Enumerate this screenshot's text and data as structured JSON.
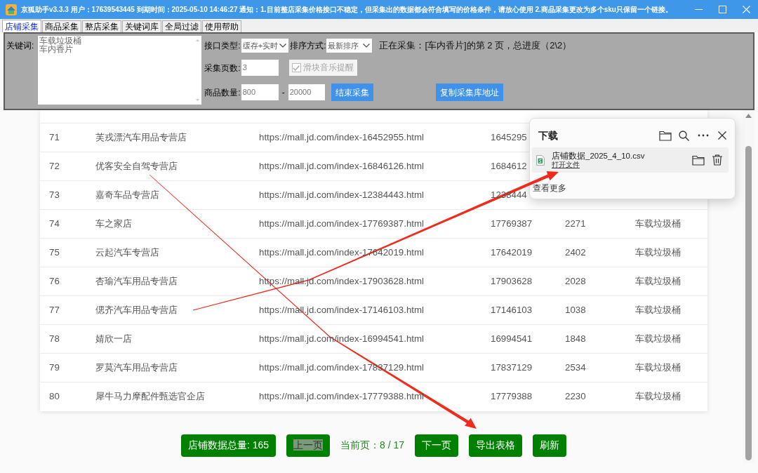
{
  "window": {
    "title": "京狐助手v3.3.3 用户：17639543445 到期时间：2025-05-10 14:46:27 通知：1.目前整店采集价格接口不稳定，但采集出的数据都会符合填写的价格条件，请放心使用 2.商品采集更改为多个sku只保留一个链接。"
  },
  "tabs": [
    {
      "label": "店铺采集",
      "selected": true
    },
    {
      "label": "商品采集",
      "selected": false
    },
    {
      "label": "整店采集",
      "selected": false
    },
    {
      "label": "关键词库",
      "selected": false
    },
    {
      "label": "全局过滤",
      "selected": false
    },
    {
      "label": "使用帮助",
      "selected": false
    }
  ],
  "controls": {
    "keywords": {
      "label": "关键词:",
      "lines": [
        "车载垃圾桶",
        "车内香片"
      ]
    },
    "interface_type": {
      "label": "接口类型:",
      "value": "缓存+实时"
    },
    "sort": {
      "label": "排序方式:",
      "value": "最新排序"
    },
    "status": "正在采集：[车内香片]的第 2 页，总进度（2\\2）",
    "pages": {
      "label": "采集页数:",
      "value": "3"
    },
    "slider_alert": {
      "label": "滑块音乐提醒",
      "checked": true,
      "disabled": true
    },
    "item_count": {
      "label": "商品数量:",
      "min": "800",
      "separator": "-",
      "max": "20000"
    },
    "buttons": [
      {
        "kind": "stop",
        "label": "结束采集"
      },
      {
        "kind": "copy",
        "label": "复制采集库地址"
      }
    ]
  },
  "table": {
    "rows": [
      {
        "cells": [
          "71",
          "芙戎漂汽车用品专营店",
          "https://mall.jd.com/index-16452955.html",
          "1645295"
        ]
      },
      {
        "cells": [
          "72",
          "优客安全自驾专营店",
          "https://mall.jd.com/index-16846126.html",
          "1684612"
        ]
      },
      {
        "cells": [
          "73",
          "嘉奇车品专营店",
          "https://mall.jd.com/index-12384443.html",
          "1238444"
        ]
      },
      {
        "cells": [
          "74",
          "车之家店",
          "https://mall.jd.com/index-17769387.html",
          "17769387",
          "2271",
          "车载垃圾桶"
        ]
      },
      {
        "cells": [
          "75",
          "云起汽车专营店",
          "https://mall.jd.com/index-17642019.html",
          "17642019",
          "2402",
          "车载垃圾桶"
        ]
      },
      {
        "cells": [
          "76",
          "杏瑜汽车用品专营店",
          "https://mall.jd.com/index-17903628.html",
          "17903628",
          "2028",
          "车载垃圾桶"
        ]
      },
      {
        "cells": [
          "77",
          "偲齐汽车用品专营店",
          "https://mall.jd.com/index-17146103.html",
          "17146103",
          "1038",
          "车载垃圾桶"
        ]
      },
      {
        "cells": [
          "78",
          "婧欣一店",
          "https://mall.jd.com/index-16994541.html",
          "16994541",
          "1848",
          "车载垃圾桶"
        ]
      },
      {
        "cells": [
          "79",
          "罗莫汽车用品专营店",
          "https://mall.jd.com/index-17837129.html",
          "17837129",
          "2534",
          "车载垃圾桶"
        ]
      },
      {
        "cells": [
          "80",
          "犀牛马力摩配件甄选官企店",
          "https://mall.jd.com/index-17779388.html",
          "17779388",
          "2230",
          "车载垃圾桶"
        ]
      }
    ]
  },
  "pager": [
    {
      "kind": "button",
      "label": "店铺数据总量: 165",
      "highlighted": false
    },
    {
      "kind": "button",
      "label": "上一页",
      "highlighted": true
    },
    {
      "kind": "text",
      "label": "当前页：8 / 17"
    },
    {
      "kind": "button",
      "label": "下一页",
      "highlighted": false
    },
    {
      "kind": "button",
      "label": "导出表格",
      "highlighted": false
    },
    {
      "kind": "button",
      "label": "刷新",
      "highlighted": false
    }
  ],
  "download_panel": {
    "title": "下载",
    "items": [
      {
        "filename": "店铺数据_2025_4_10.csv",
        "action": "打开文件"
      }
    ],
    "more": "查看更多"
  },
  "annotation_arrows": [
    {
      "kind": "arrow"
    },
    {
      "kind": "arrow"
    }
  ]
}
